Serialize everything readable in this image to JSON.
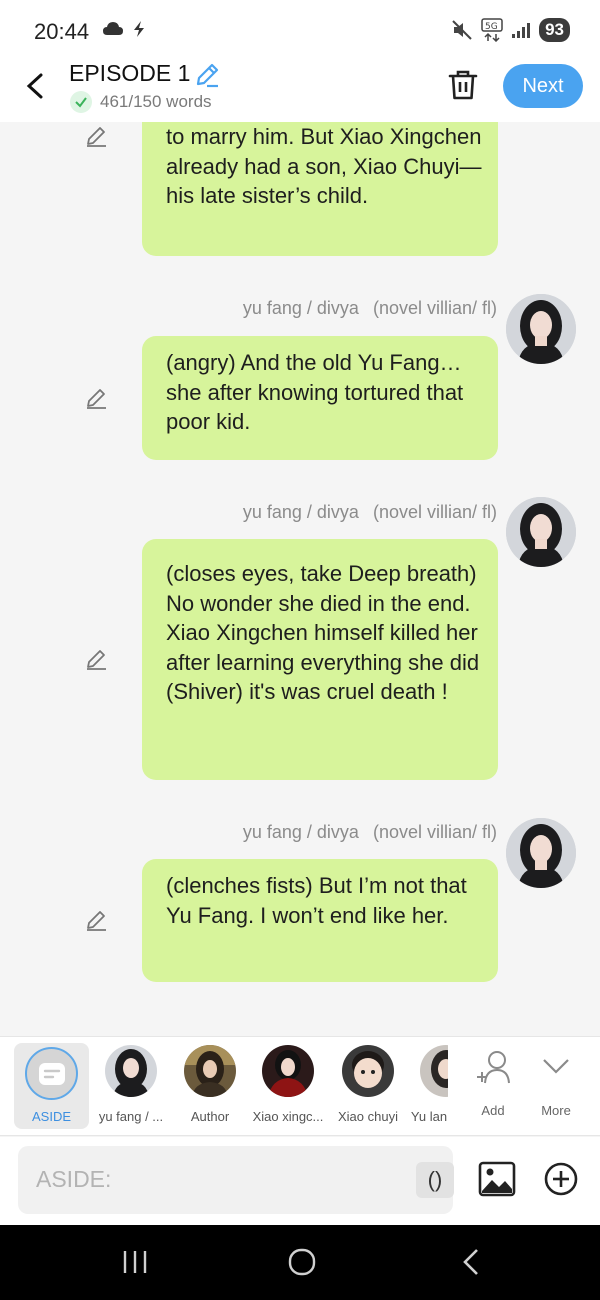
{
  "status_bar": {
    "time": "20:44",
    "battery": "93",
    "network": "5G"
  },
  "header": {
    "title": "EPISODE 1",
    "word_count": "461/150 words",
    "next_label": "Next"
  },
  "messages": [
    {
      "speaker": "",
      "role": "",
      "text": "to marry him. But Xiao Xingchen already had a son, Xiao Chuyi—his late sister’s child."
    },
    {
      "speaker": "yu fang / divya",
      "role": "(novel villian/ fl)",
      "text": "(angry) And the old Yu Fang… she after knowing tortured that poor kid."
    },
    {
      "speaker": "yu fang / divya",
      "role": "(novel villian/ fl)",
      "text": "(closes eyes, take Deep breath) No wonder she died in the end. Xiao Xingchen himself killed her after learning everything she did (Shiver) it's was cruel death !"
    },
    {
      "speaker": "yu fang / divya",
      "role": "(novel villian/ fl)",
      "text": "(clenches fists) But I’m not that Yu Fang. I won’t end like her."
    }
  ],
  "characters": [
    {
      "label": "ASIDE",
      "icon": "aside-bubble-icon"
    },
    {
      "label": "yu fang / ...",
      "icon": "avatar"
    },
    {
      "label": "Author",
      "icon": "avatar"
    },
    {
      "label": "Xiao xingc...",
      "icon": "avatar"
    },
    {
      "label": "Xiao chuyi",
      "icon": "avatar"
    },
    {
      "label": "Yu lan",
      "icon": "avatar"
    }
  ],
  "char_actions": {
    "add_label": "Add",
    "more_label": "More"
  },
  "input": {
    "placeholder": "ASIDE:",
    "paren_label": "()"
  },
  "colors": {
    "bubble": "#d7f49b",
    "accent": "#4aa3f0",
    "background": "#f5f5f5"
  }
}
